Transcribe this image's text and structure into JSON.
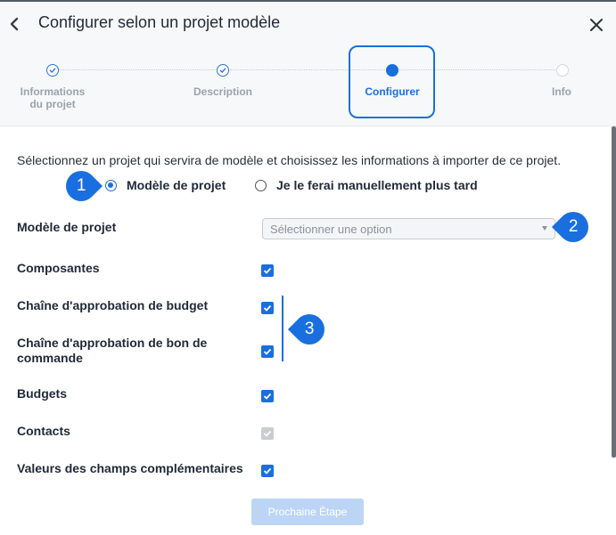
{
  "dialog": {
    "title": "Configurer selon un projet modèle"
  },
  "stepper": {
    "steps": [
      {
        "label": "Informations du projet",
        "state": "done"
      },
      {
        "label": "Description",
        "state": "done"
      },
      {
        "label": "Configurer",
        "state": "current"
      },
      {
        "label": "Info",
        "state": "future"
      }
    ]
  },
  "intro": "Sélectionnez un projet qui servira de modèle et choisissez les informations à importer de ce projet.",
  "mode_options": [
    {
      "label": "Modèle de projet",
      "selected": true
    },
    {
      "label": "Je le ferai manuellement plus tard",
      "selected": false
    }
  ],
  "template_field": {
    "label": "Modèle de projet",
    "placeholder": "Sélectionner une option"
  },
  "import_options": [
    {
      "label": "Composantes",
      "checked": true,
      "disabled": false
    },
    {
      "label": "Chaîne d'approbation de budget",
      "checked": true,
      "disabled": false
    },
    {
      "label": "Chaîne d'approbation de bon de commande",
      "checked": true,
      "disabled": false
    },
    {
      "label": "Budgets",
      "checked": true,
      "disabled": false
    },
    {
      "label": "Contacts",
      "checked": true,
      "disabled": true
    },
    {
      "label": "Valeurs des champs complémentaires",
      "checked": true,
      "disabled": false
    }
  ],
  "callouts": [
    "1",
    "2",
    "3"
  ],
  "footer": {
    "next_label": "Prochaine Étape"
  },
  "colors": {
    "accent": "#1a6fe0",
    "header_bg": "#f7f8fa",
    "disabled_button": "#bcd5f5"
  }
}
